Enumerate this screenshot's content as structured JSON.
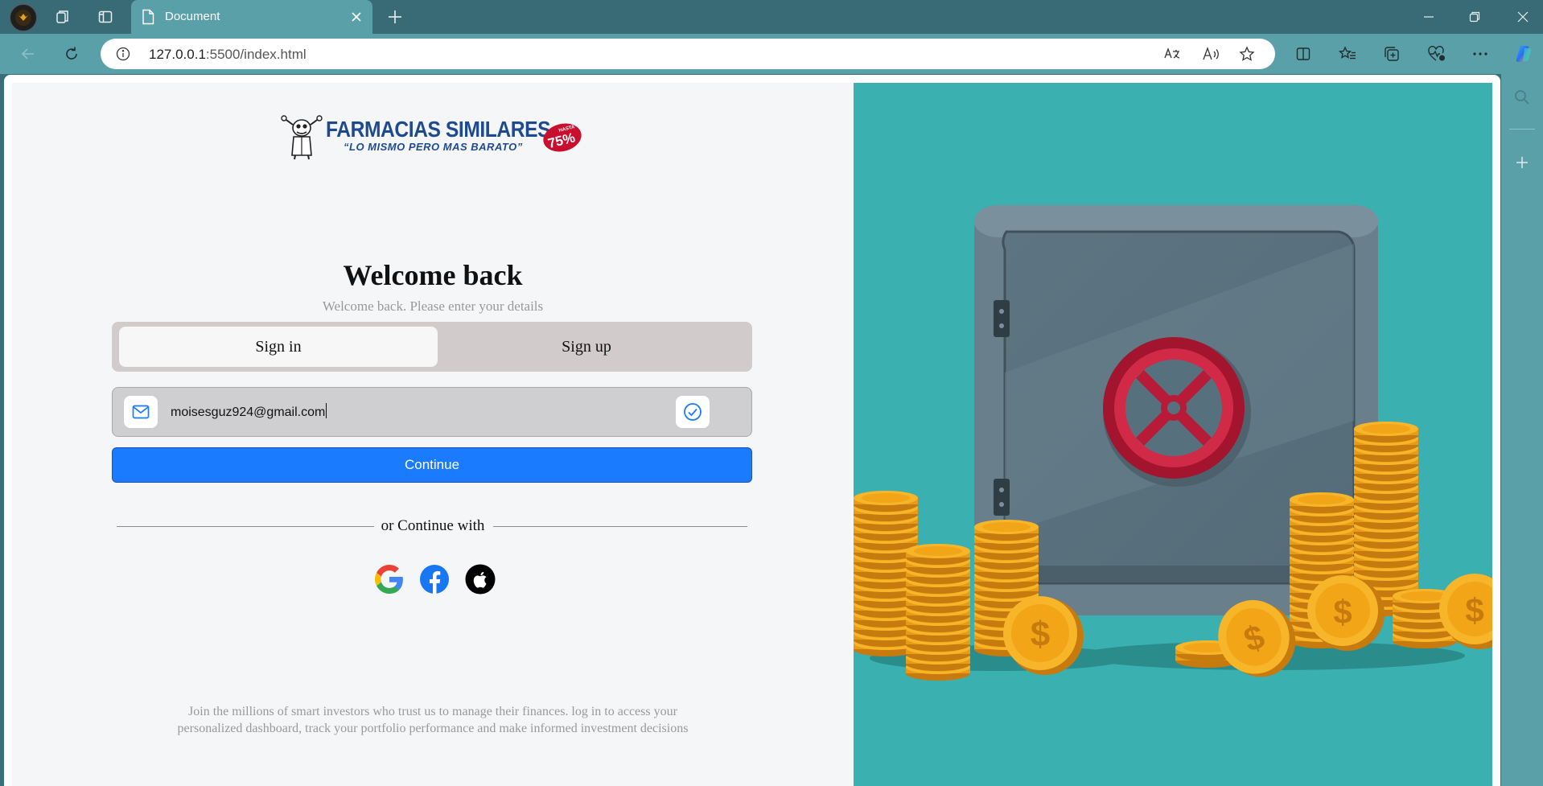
{
  "browser": {
    "tab_title": "Document",
    "url_host": "127.0.0.1",
    "url_rest": ":5500/index.html",
    "icons": [
      "profile-icon",
      "workspaces-icon",
      "vertical-tabs-icon",
      "page-icon",
      "close-icon",
      "new-tab-icon",
      "minimize-icon",
      "restore-icon",
      "close-window-icon",
      "back-icon",
      "refresh-icon",
      "info-icon",
      "translate-icon",
      "read-aloud-icon",
      "favorite-star-icon",
      "split-screen-icon",
      "favorites-icon",
      "collections-icon",
      "browser-essentials-icon",
      "more-icon",
      "copilot-icon",
      "search-icon",
      "add-icon"
    ],
    "colors": {
      "titlebar": "#386b76",
      "toolbar": "#5aa0a9"
    }
  },
  "logo": {
    "name": "FARMACIAS SIMILARES",
    "tagline": "“LO MISMO PERO MAS BARATO”",
    "badge_top": "HASTA",
    "badge_value": "75%"
  },
  "form": {
    "heading": "Welcome back",
    "subheading": "Welcome back. Please enter your details",
    "tabs": [
      {
        "label": "Sign in",
        "active": true
      },
      {
        "label": "Sign up",
        "active": false
      }
    ],
    "email_value": "moisesguz924@gmail.com",
    "continue_label": "Continue",
    "divider_label": "or Continue with",
    "social": [
      "google-icon",
      "facebook-icon",
      "apple-icon"
    ],
    "footer": "Join the millions of smart investors who trust us to manage their finances. log in to access your personalized dashboard, track your portfolio performance and make informed investment decisions",
    "colors": {
      "primary": "#1a7bff",
      "panel_bg": "#f5f6f8",
      "illustration_bg": "#3bb0b0"
    }
  }
}
